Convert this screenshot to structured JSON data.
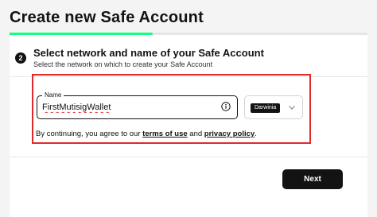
{
  "page": {
    "title": "Create new Safe Account"
  },
  "progress": {
    "fraction": 0.4,
    "color": "#12ff80"
  },
  "step": {
    "number": "2",
    "title": "Select network and name of your Safe Account",
    "subtitle": "Select the network on which to create your Safe Account"
  },
  "name_field": {
    "label": "Name",
    "value": "FirstMutisigWallet",
    "icon": "info-icon"
  },
  "network_select": {
    "selected": "Darwinia",
    "icon": "chevron-down-icon"
  },
  "terms": {
    "prefix": "By continuing, you agree to our ",
    "terms_link": "terms of use",
    "middle": " and ",
    "privacy_link": "privacy policy",
    "suffix": "."
  },
  "actions": {
    "next_label": "Next"
  },
  "colors": {
    "accent": "#12ff80",
    "highlight_border": "#e02a2a",
    "primary_button": "#121312"
  }
}
